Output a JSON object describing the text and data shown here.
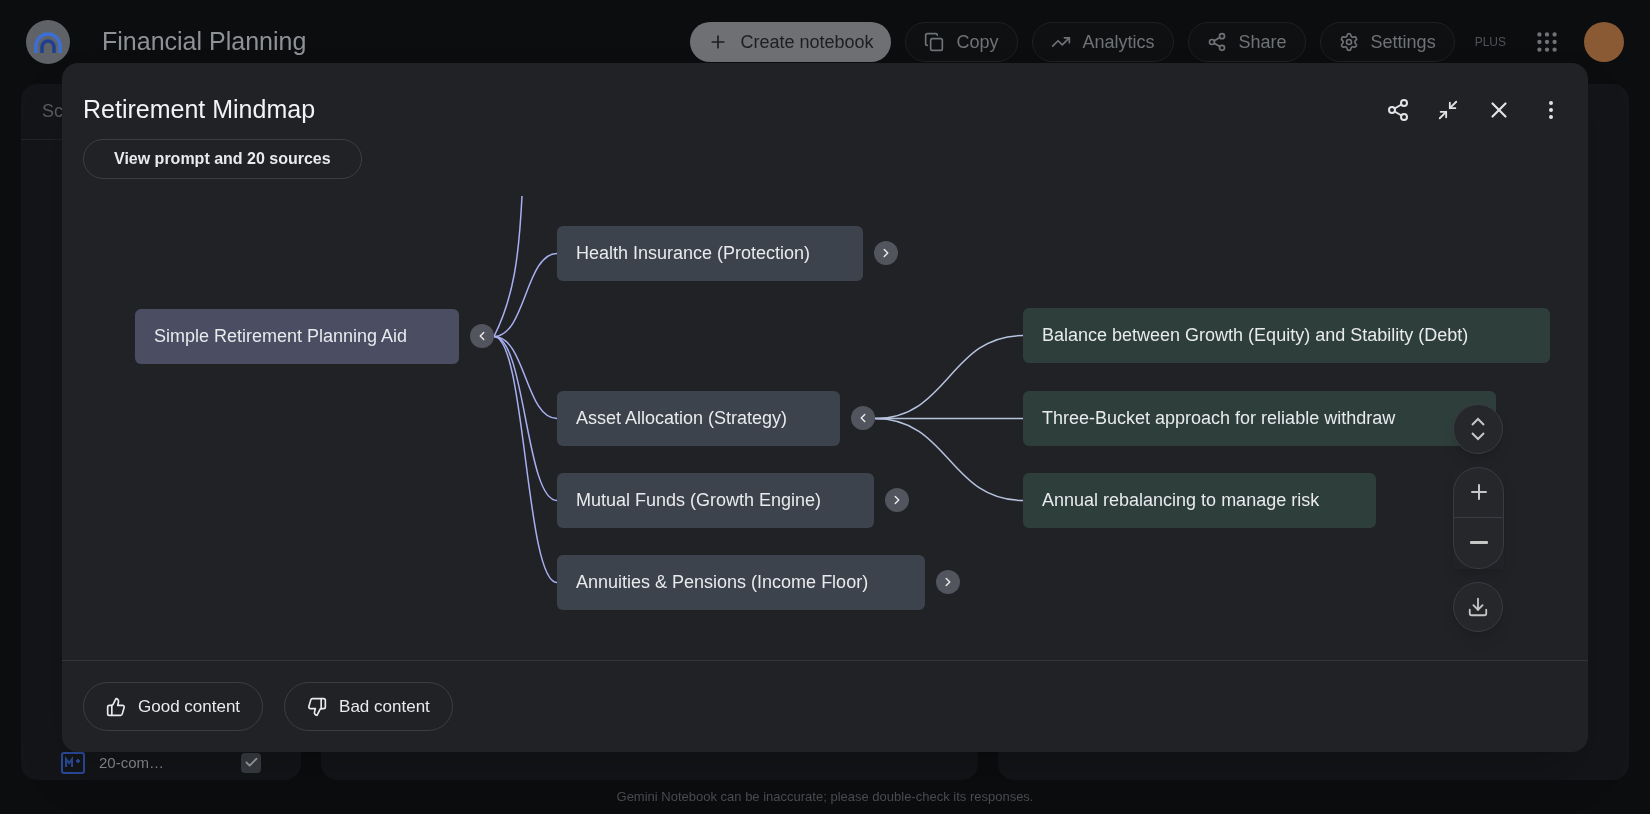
{
  "app": {
    "title": "Financial Planning"
  },
  "toolbar": [
    {
      "label": "Create notebook",
      "kind": "create"
    },
    {
      "label": "Copy",
      "kind": "copy"
    },
    {
      "label": "Analytics",
      "kind": "analytics"
    },
    {
      "label": "Share",
      "kind": "share"
    },
    {
      "label": "Settings",
      "kind": "settings"
    }
  ],
  "plan_badge": "PLUS",
  "sources_panel": {
    "title": "Sc",
    "item": {
      "label": "20-com…",
      "checked": true
    }
  },
  "footer_note": "Gemini Notebook can be inaccurate; please double-check its responses.",
  "dialog": {
    "title": "Retirement Mindmap",
    "sources_button": "View prompt and 20 sources",
    "mindmap": {
      "label": "Simple Retirement Planning Aid",
      "expanded": true,
      "children": [
        {
          "label": "Health Insurance (Protection)",
          "expanded": false
        },
        {
          "label": "Asset Allocation (Strategy)",
          "expanded": true,
          "children": [
            {
              "label": "Balance between Growth (Equity) and Stability (Debt)"
            },
            {
              "label": "Three-Bucket approach for reliable withdraw"
            },
            {
              "label": "Annual rebalancing to manage risk"
            }
          ]
        },
        {
          "label": "Mutual Funds (Growth Engine)",
          "expanded": false
        },
        {
          "label": "Annuities & Pensions (Income Floor)",
          "expanded": false
        }
      ]
    },
    "feedback": [
      {
        "label": "Good content",
        "kind": "good"
      },
      {
        "label": "Bad content",
        "kind": "bad"
      }
    ]
  }
}
